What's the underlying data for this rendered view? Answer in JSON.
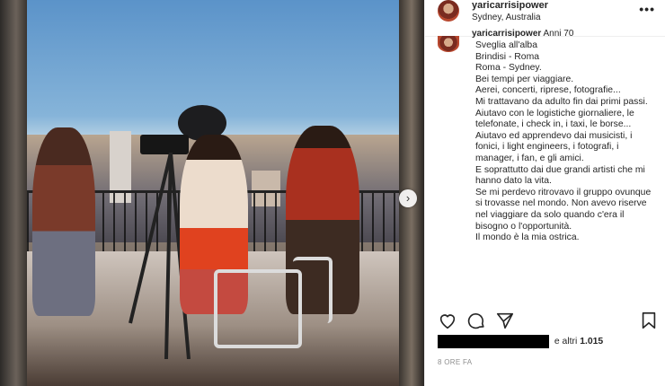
{
  "post": {
    "username": "yaricarrisipower",
    "location": "Sydney, Australia",
    "more_label": "•••",
    "caption_username": "yaricarrisipower",
    "caption_suffix": "Anni 70",
    "caption_lines": [
      "Sveglia all'alba",
      "Brindisi - Roma",
      "Roma - Sydney.",
      "Bei tempi per viaggiare.",
      "Aerei, concerti, riprese, fotografie...",
      "Mi trattavano da adulto fin dai primi passi.",
      "Aiutavo con le logistiche giornaliere, le telefonate, i check in, i taxi, le borse...",
      "Aiutavo ed apprendevo dai musicisti, i fonici, i light engineers, i fotografi, i manager, i fan, e gli amici.",
      "E soprattutto dai due grandi artisti che mi hanno dato la vita.",
      "Se mi perdevo ritrovavo il gruppo ovunque si trovasse nel mondo. Non avevo riserve nel viaggiare da solo quando c'era il bisogno o l'opportunità.",
      "Il mondo è la mia ostrica."
    ],
    "likes_text": "e altri",
    "likes_count": "1.015",
    "time_ago": "8 ORE FA",
    "icons": [
      "heart-icon",
      "comment-icon",
      "share-icon",
      "bookmark-icon",
      "chevron-right-icon"
    ]
  }
}
